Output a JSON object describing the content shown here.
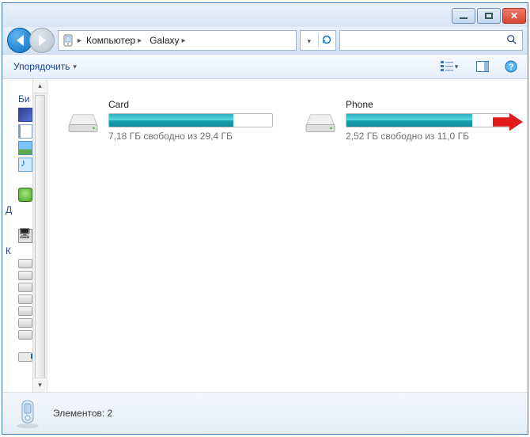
{
  "titlebar": {
    "min": "—",
    "max": "▢",
    "close": "✕"
  },
  "breadcrumb": {
    "segments": [
      "Компьютер",
      "Galaxy"
    ]
  },
  "toolbar": {
    "organize": "Упорядочить"
  },
  "sidebar": {
    "lib_label": "Би",
    "home_label": "Д",
    "comp_label": "К"
  },
  "drives": [
    {
      "name": "Card",
      "subtitle": "7,18 ГБ свободно из 29,4 ГБ",
      "used_pct": 76
    },
    {
      "name": "Phone",
      "subtitle": "2,52 ГБ свободно из 11,0 ГБ",
      "used_pct": 77
    }
  ],
  "status": {
    "text": "Элементов: 2"
  }
}
